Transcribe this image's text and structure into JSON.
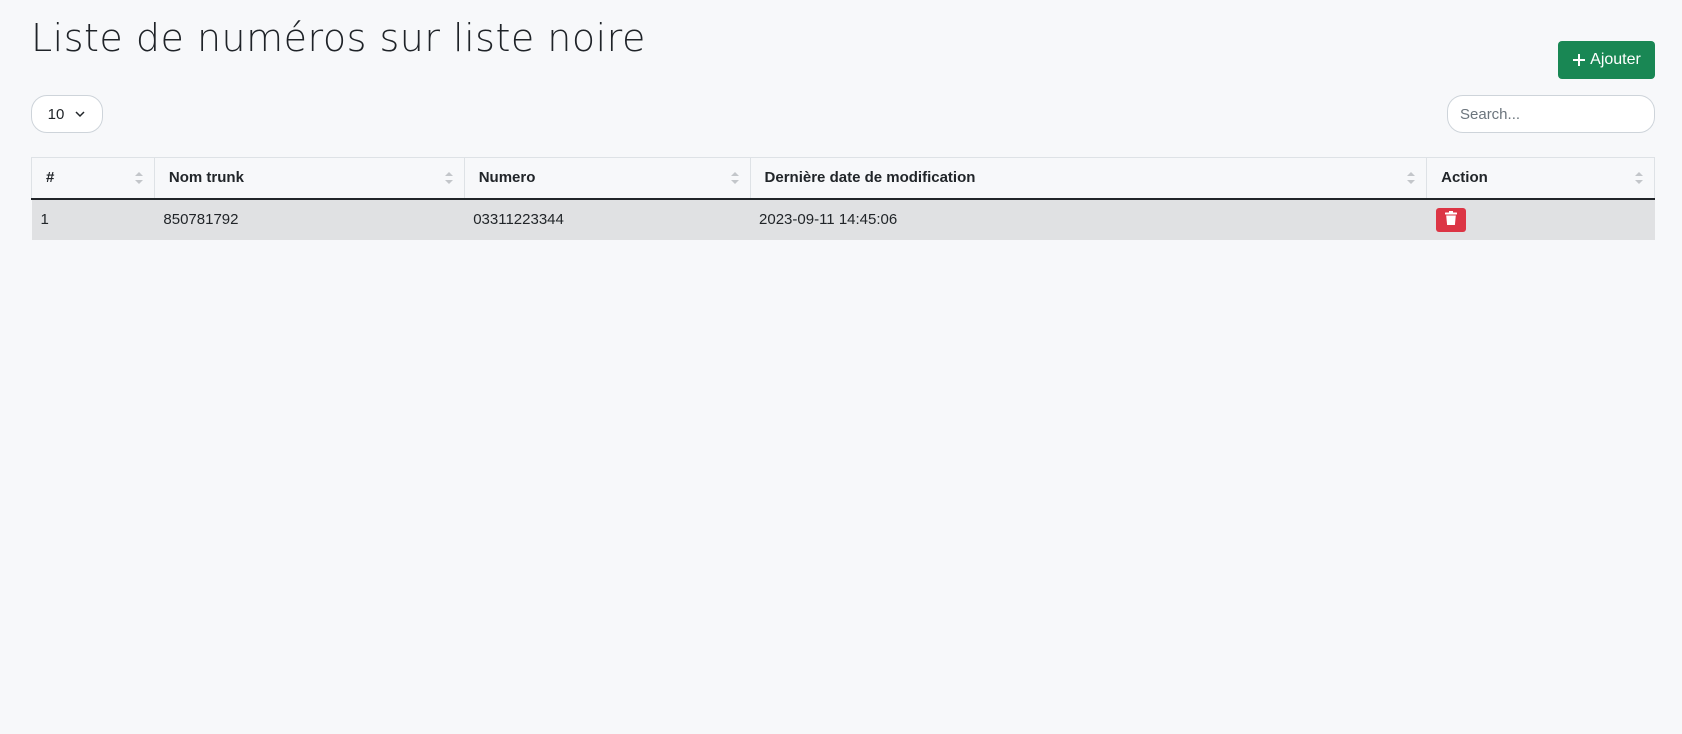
{
  "page": {
    "title": "Liste de numéros sur liste noire"
  },
  "toolbar": {
    "add_label": "Ajouter",
    "page_size": "10",
    "search_placeholder": "Search...",
    "search_value": ""
  },
  "table": {
    "columns": [
      "#",
      "Nom trunk",
      "Numero",
      "Dernière date de modification",
      "Action"
    ],
    "rows": [
      {
        "index": "1",
        "trunk": "850781792",
        "numero": "03311223344",
        "date": "2023-09-11 14:45:06"
      }
    ]
  },
  "icons": {
    "add": "plus-icon",
    "page_size": "chevron-down-icon",
    "sort": "sort-icon",
    "delete": "trash-icon"
  },
  "colors": {
    "background": "#f7f8fa",
    "add_button": "#198754",
    "delete_button": "#dc3545",
    "row_background": "#e0e1e3"
  }
}
